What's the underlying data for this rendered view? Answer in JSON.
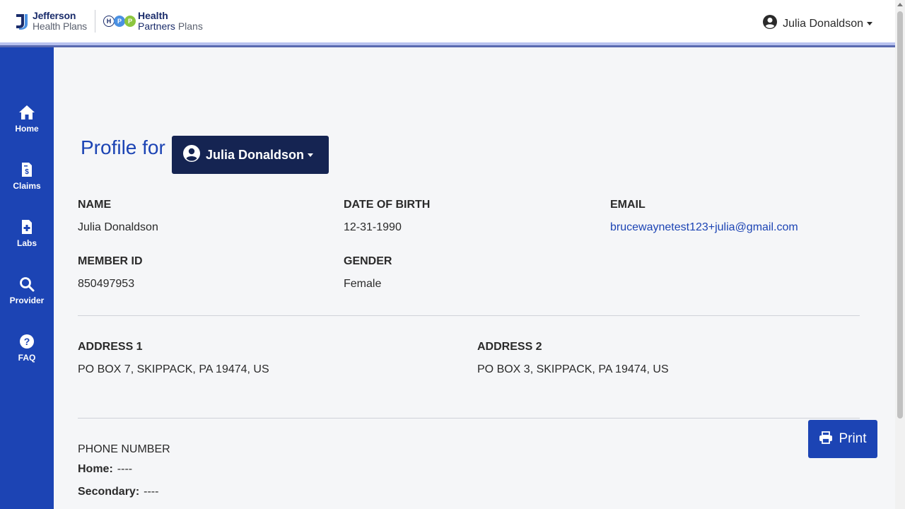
{
  "header": {
    "logo_jefferson_line1": "Jefferson",
    "logo_jefferson_line2": "Health Plans",
    "logo_hpp_line1": "Health",
    "logo_hpp_line2a": "Partners",
    "logo_hpp_line2b": "Plans",
    "user_name": "Julia Donaldson"
  },
  "sidebar": {
    "items": [
      {
        "label": "Home",
        "icon": "home-icon"
      },
      {
        "label": "Claims",
        "icon": "claims-icon"
      },
      {
        "label": "Labs",
        "icon": "labs-icon"
      },
      {
        "label": "Provider",
        "icon": "search-icon"
      },
      {
        "label": "FAQ",
        "icon": "question-icon"
      }
    ]
  },
  "profile": {
    "title": "Profile for",
    "selected_member": "Julia Donaldson",
    "name_label": "NAME",
    "name_value": "Julia Donaldson",
    "dob_label": "DATE OF BIRTH",
    "dob_value": "12-31-1990",
    "email_label": "EMAIL",
    "email_value": "brucewaynetest123+julia@gmail.com",
    "member_id_label": "MEMBER ID",
    "member_id_value": "850497953",
    "gender_label": "GENDER",
    "gender_value": "Female",
    "address1_label": "ADDRESS 1",
    "address1_value": "PO BOX 7, SKIPPACK, PA 19474, US",
    "address2_label": "ADDRESS 2",
    "address2_value": "PO BOX 3, SKIPPACK, PA 19474, US",
    "phone_title": "PHONE NUMBER",
    "phone_home_label": "Home:",
    "phone_home_value": "----",
    "phone_secondary_label": "Secondary:",
    "phone_secondary_value": "----"
  },
  "actions": {
    "print_label": "Print"
  },
  "colors": {
    "brand_blue": "#1c44b4",
    "navy": "#152452",
    "hpp_blue": "#4a90e2",
    "hpp_green": "#8cc63f"
  }
}
